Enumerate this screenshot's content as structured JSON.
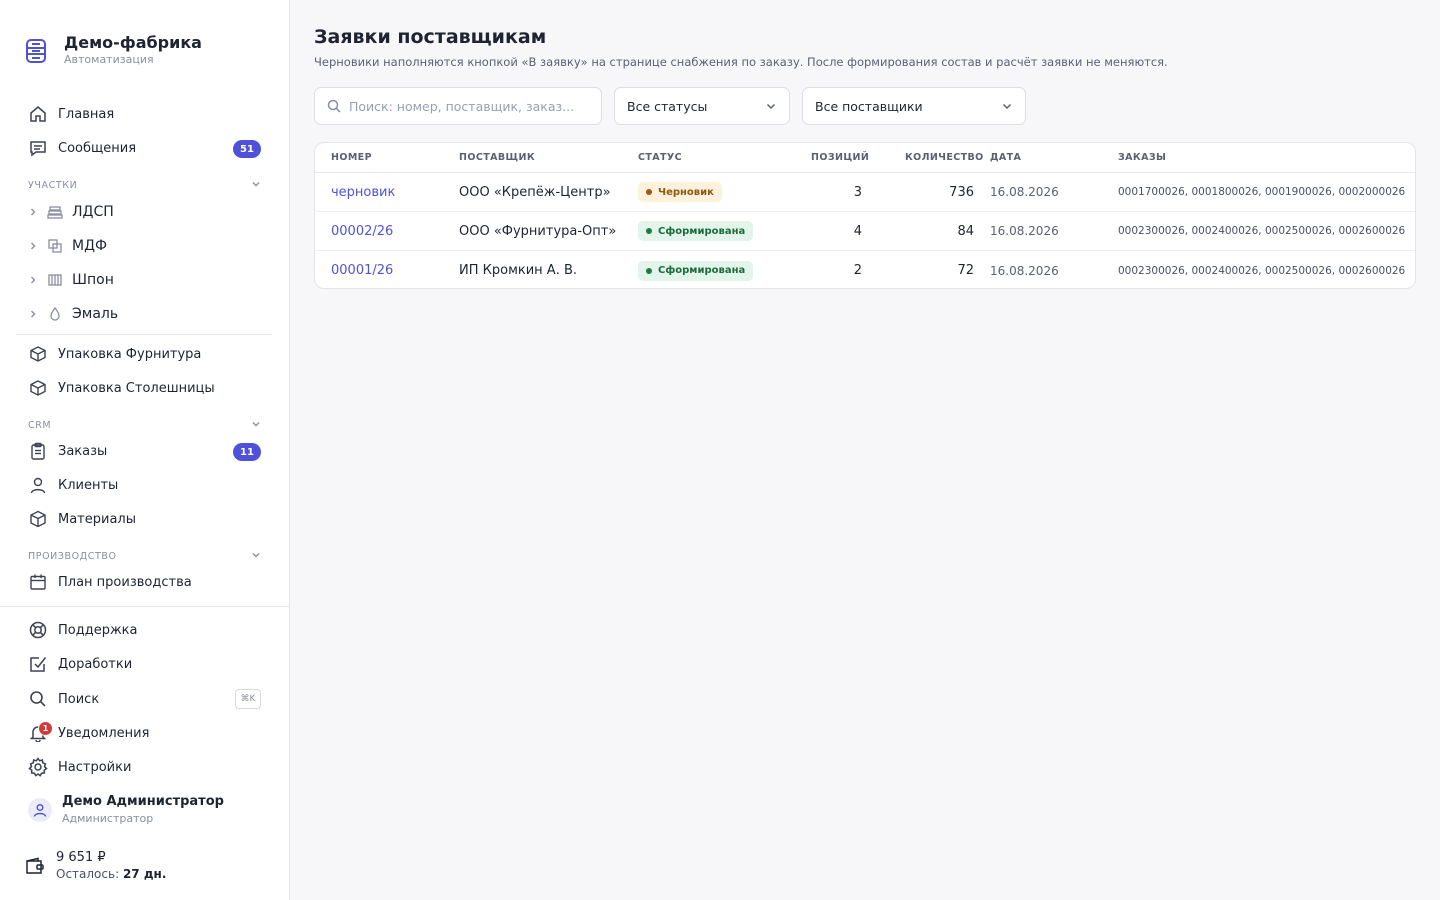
{
  "brand": {
    "title": "Демо-фабрика",
    "subtitle": "Автоматизация"
  },
  "nav": {
    "home": "Главная",
    "messages": {
      "label": "Сообщения",
      "badge": "51"
    },
    "sections": {
      "areas": "УЧАСТКИ",
      "crm": "CRM",
      "production": "ПРОИЗВОДСТВО"
    },
    "areas": [
      "ЛДСП",
      "МДФ",
      "Шпон",
      "Эмаль"
    ],
    "packing_fittings": "Упаковка Фурнитура",
    "packing_tops": "Упаковка Столешницы",
    "orders": {
      "label": "Заказы",
      "badge": "11"
    },
    "clients": "Клиенты",
    "materials": "Материалы",
    "plan": "План производства",
    "support": "Поддержка",
    "improvements": "Доработки",
    "search": {
      "label": "Поиск",
      "shortcut": "⌘K"
    },
    "notifications": {
      "label": "Уведомления",
      "count": "1"
    },
    "settings": "Настройки"
  },
  "user": {
    "name": "Демо Администратор",
    "role": "Администратор"
  },
  "wallet": {
    "amount": "9 651 ₽",
    "left_label": "Осталось:",
    "left_value": "27 дн."
  },
  "page": {
    "title": "Заявки поставщикам",
    "subtitle": "Черновики наполняются кнопкой «В заявку» на странице снабжения по заказу. После формирования состав и расчёт заявки не меняются."
  },
  "filters": {
    "search_placeholder": "Поиск: номер, поставщик, заказ...",
    "status": "Все статусы",
    "supplier": "Все поставщики"
  },
  "table": {
    "headers": {
      "number": "НОМЕР",
      "supplier": "ПОСТАВЩИК",
      "status": "СТАТУС",
      "positions": "ПОЗИЦИЙ",
      "quantity": "КОЛИЧЕСТВО",
      "date": "ДАТА",
      "orders": "ЗАКАЗЫ"
    },
    "rows": [
      {
        "number": "черновик",
        "supplier": "ООО «Крепёж-Центр»",
        "status": "Черновик",
        "status_kind": "draft",
        "positions": "3",
        "quantity": "736",
        "date": "16.08.2026",
        "orders": "0001700026, 0001800026, 0001900026, 0002000026"
      },
      {
        "number": "00002/26",
        "supplier": "ООО «Фурнитура-Опт»",
        "status": "Сформирована",
        "status_kind": "formed",
        "positions": "4",
        "quantity": "84",
        "date": "16.08.2026",
        "orders": "0002300026, 0002400026, 0002500026, 0002600026"
      },
      {
        "number": "00001/26",
        "supplier": "ИП Кромкин А. В.",
        "status": "Сформирована",
        "status_kind": "formed",
        "positions": "2",
        "quantity": "72",
        "date": "16.08.2026",
        "orders": "0002300026, 0002400026, 0002500026, 0002600026"
      }
    ]
  },
  "colors": {
    "accent": "#4f52d9",
    "draft_bg": "#fdf1dc",
    "formed_bg": "#e3f5ea",
    "notification": "#d23b3b"
  }
}
